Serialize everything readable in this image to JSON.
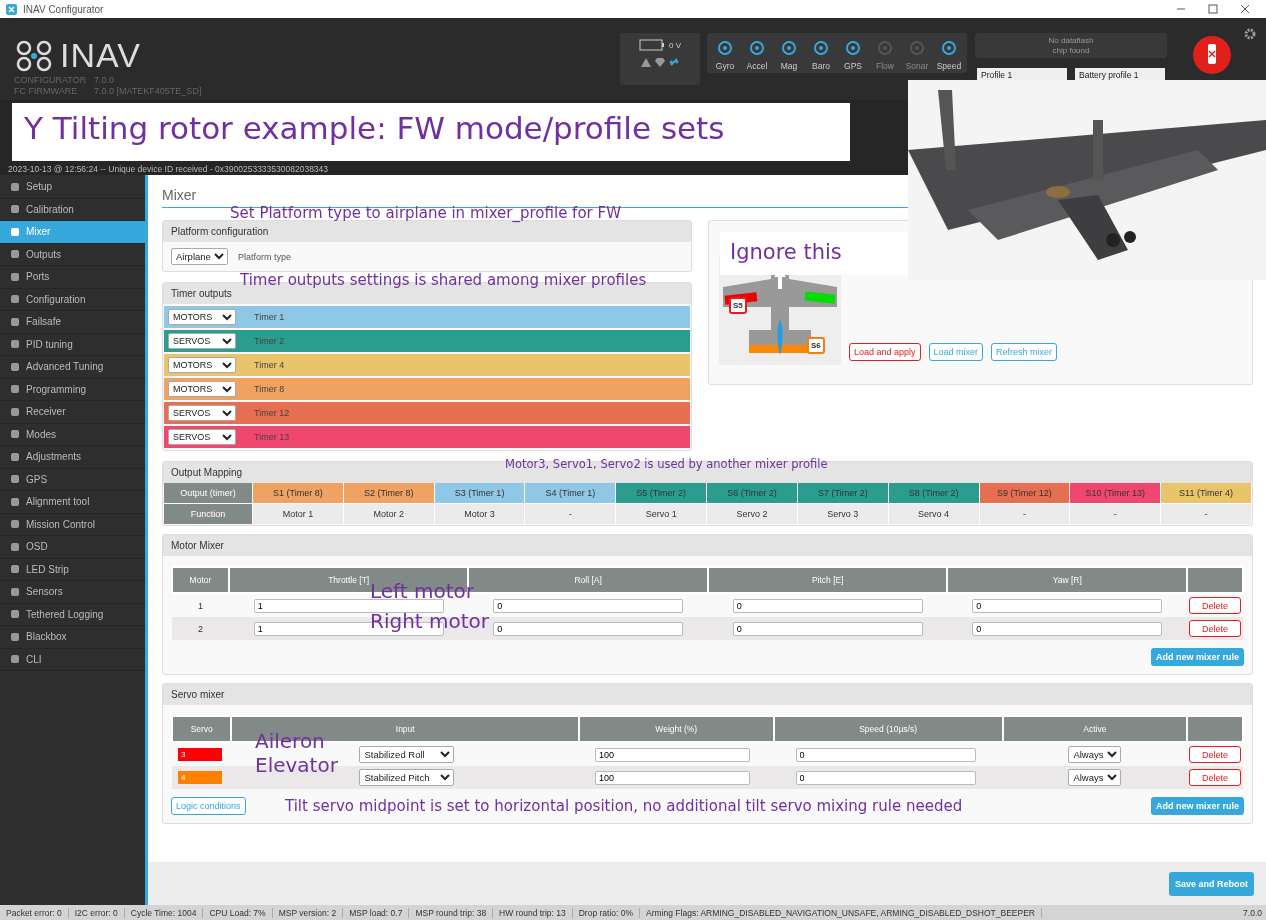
{
  "window": {
    "title": "INAV Configurator"
  },
  "header": {
    "logo": "INAV",
    "app": "CONFIGURATOR",
    "app_version": "7.0.0",
    "fw_label": "FC FIRMWARE",
    "fw_version": "7.0.0 [MATEKF405TE_SD]",
    "battery": "0 V",
    "sensors": [
      {
        "label": "Gyro",
        "on": true
      },
      {
        "label": "Accel",
        "on": true
      },
      {
        "label": "Mag",
        "on": true
      },
      {
        "label": "Baro",
        "on": true
      },
      {
        "label": "GPS",
        "on": true
      },
      {
        "label": "Flow",
        "on": false
      },
      {
        "label": "Sonar",
        "on": false
      },
      {
        "label": "Speed",
        "on": true
      }
    ],
    "dataflash": [
      "No dataflash",
      "chip found"
    ],
    "profile": "Profile 1",
    "battery_profile": "Battery profile 1"
  },
  "log": [
    "2023-10-13 @ 12:56:24 -- Unique device ID received - 0x3900253333530082038343"
  ],
  "sidebar": {
    "items": [
      {
        "label": "Setup",
        "selected": false
      },
      {
        "label": "Calibration",
        "selected": false
      },
      {
        "label": "Mixer",
        "selected": true
      },
      {
        "label": "Outputs",
        "selected": false
      },
      {
        "label": "Ports",
        "selected": false
      },
      {
        "label": "Configuration",
        "selected": false
      },
      {
        "label": "Failsafe",
        "selected": false
      },
      {
        "label": "PID tuning",
        "selected": false
      },
      {
        "label": "Advanced Tuning",
        "selected": false
      },
      {
        "label": "Programming",
        "selected": false
      },
      {
        "label": "Receiver",
        "selected": false
      },
      {
        "label": "Modes",
        "selected": false
      },
      {
        "label": "Adjustments",
        "selected": false
      },
      {
        "label": "GPS",
        "selected": false
      },
      {
        "label": "Alignment tool",
        "selected": false
      },
      {
        "label": "Mission Control",
        "selected": false
      },
      {
        "label": "OSD",
        "selected": false
      },
      {
        "label": "LED Strip",
        "selected": false
      },
      {
        "label": "Sensors",
        "selected": false
      },
      {
        "label": "Tethered Logging",
        "selected": false
      },
      {
        "label": "Blackbox",
        "selected": false
      },
      {
        "label": "CLI",
        "selected": false
      }
    ]
  },
  "page_title": "Mixer",
  "platform": {
    "title": "Platform configuration",
    "type": "Airplane",
    "label": "Platform type"
  },
  "timers": {
    "title": "Timer outputs",
    "rows": [
      {
        "mode": "MOTORS",
        "label": "Timer 1",
        "color": "#8ec8e6"
      },
      {
        "mode": "SERVOS",
        "label": "Timer 2",
        "color": "#2a9d8f"
      },
      {
        "mode": "MOTORS",
        "label": "Timer 4",
        "color": "#e9c46a"
      },
      {
        "mode": "MOTORS",
        "label": "Timer 8",
        "color": "#f0a262"
      },
      {
        "mode": "SERVOS",
        "label": "Timer 12",
        "color": "#e76f51"
      },
      {
        "mode": "SERVOS",
        "label": "Timer 13",
        "color": "#ef476f"
      }
    ]
  },
  "presets": {
    "servo_tags": [
      {
        "label": "S5",
        "color": "#e02020"
      },
      {
        "label": "S6",
        "color": "#f08010"
      }
    ],
    "buttons": [
      {
        "label": "Load and apply",
        "kind": "danger"
      },
      {
        "label": "Load mixer",
        "kind": "info"
      },
      {
        "label": "Refresh mixer",
        "kind": "info"
      }
    ]
  },
  "output_mapping": {
    "title": "Output Mapping",
    "row_headers": [
      "Output (timer)",
      "Function"
    ],
    "outputs": [
      {
        "output": "S1 (Timer 8)",
        "function": "Motor 1",
        "color": "#f0a262"
      },
      {
        "output": "S2 (Timer 8)",
        "function": "Motor 2",
        "color": "#f0a262"
      },
      {
        "output": "S3 (Timer 1)",
        "function": "Motor 3",
        "color": "#8ec8e6"
      },
      {
        "output": "S4 (Timer 1)",
        "function": "-",
        "color": "#8ec8e6"
      },
      {
        "output": "S5 (Timer 2)",
        "function": "Servo 1",
        "color": "#2a9d8f"
      },
      {
        "output": "S6 (Timer 2)",
        "function": "Servo 2",
        "color": "#2a9d8f"
      },
      {
        "output": "S7 (Timer 2)",
        "function": "Servo 3",
        "color": "#2a9d8f"
      },
      {
        "output": "S8 (Timer 2)",
        "function": "Servo 4",
        "color": "#2a9d8f"
      },
      {
        "output": "S9 (Timer 12)",
        "function": "-",
        "color": "#e76f51"
      },
      {
        "output": "S10 (Timer 13)",
        "function": "-",
        "color": "#ef476f"
      },
      {
        "output": "S11 (Timer 4)",
        "function": "-",
        "color": "#e9c46a"
      }
    ]
  },
  "motor_mixer": {
    "title": "Motor Mixer",
    "columns": [
      "Motor",
      "Throttle [T]",
      "Roll [A]",
      "Pitch [E]",
      "Yaw [R]"
    ],
    "rows": [
      {
        "motor": "1",
        "throttle": "1",
        "roll": "0",
        "pitch": "0",
        "yaw": "0",
        "action": "Delete"
      },
      {
        "motor": "2",
        "throttle": "1",
        "roll": "0",
        "pitch": "0",
        "yaw": "0",
        "action": "Delete"
      }
    ],
    "add_button": "Add new mixer rule"
  },
  "servo_mixer": {
    "title": "Servo mixer",
    "columns": [
      "Servo",
      "Input",
      "Weight (%)",
      "Speed (10µs/s)",
      "Active"
    ],
    "rows": [
      {
        "servo": "3",
        "color": "#ff0000",
        "input": "Stabilized Roll",
        "weight": "100",
        "speed": "0",
        "active": "Always",
        "action": "Delete"
      },
      {
        "servo": "4",
        "color": "#ff8000",
        "input": "Stabilized Pitch",
        "weight": "100",
        "speed": "0",
        "active": "Always",
        "action": "Delete"
      }
    ],
    "logic_button": "Logic conditions",
    "add_button": "Add new mixer rule"
  },
  "save_button": "Save and Reboot",
  "status_bar": {
    "items": [
      "Packet error: 0",
      "I2C error: 0",
      "Cycle Time: 1004",
      "CPU Load: 7%",
      "MSP version: 2",
      "MSP load: 0.7",
      "MSP round trip: 38",
      "HW round trip: 13",
      "Drop ratio: 0%",
      "Arming Flags: ARMING_DISABLED_NAVIGATION_UNSAFE, ARMING_DISABLED_DSHOT_BEEPER"
    ],
    "version": "7.0.0"
  },
  "photo": {
    "kind": "picture"
  },
  "annotations": [
    {
      "text": "Y Tilting rotor example: FW mode/profile sets",
      "kind": "banner"
    },
    {
      "text": "Set Platform type to airplane in mixer_profile for FW",
      "kind": "note"
    },
    {
      "text": "Ignore this",
      "kind": "box"
    },
    {
      "text": "Timer outputs settings is shared among mixer profiles",
      "kind": "note"
    },
    {
      "text": "Motor3, Servo1, Servo2  is used by another mixer profile",
      "kind": "small"
    },
    {
      "text": "Left motor",
      "kind": "label"
    },
    {
      "text": "Right motor",
      "kind": "label"
    },
    {
      "text": "Aileron",
      "kind": "label"
    },
    {
      "text": "Elevator",
      "kind": "label"
    },
    {
      "text": "Tilt servo midpoint is set to horizontal position, no additional tilt servo mixing rule needed",
      "kind": "note"
    }
  ]
}
